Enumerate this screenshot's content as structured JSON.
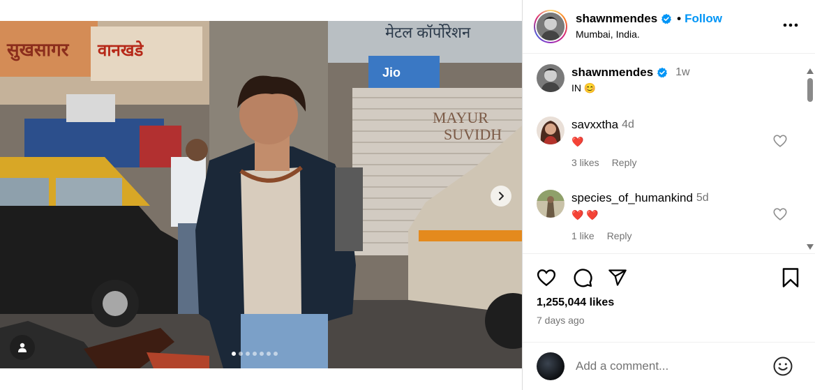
{
  "post": {
    "username": "shawnmendes",
    "follow_label": "Follow",
    "location": "Mumbai, India.",
    "caption": {
      "username": "shawnmendes",
      "time": "1w",
      "text": "IN 😊"
    },
    "media": {
      "carousel_count": 7,
      "active_index": 0,
      "signage": {
        "sign1": "सुखसागर",
        "sign2": "वानखडे",
        "corp": "मेटल कॉर्पोरेशन",
        "jio": "Jio",
        "mayur1": "MAYUR",
        "mayur2": "SUVIDH"
      }
    },
    "comments": [
      {
        "username": "savxxtha",
        "time": "4d",
        "text": "❤️",
        "likes": "3 likes",
        "reply": "Reply"
      },
      {
        "username": "species_of_humankind",
        "time": "5d",
        "text": "❤️ ❤️",
        "likes": "1 like",
        "reply": "Reply"
      }
    ],
    "likes_count": "1,255,044 likes",
    "posted": "7 days ago",
    "add_comment_placeholder": "Add a comment...",
    "icons": {
      "like": "heart-icon",
      "comment": "comment-bubble-icon",
      "share": "paper-plane-icon",
      "save": "bookmark-icon",
      "more": "more-horizontal-icon",
      "verified": "verified-badge-icon",
      "emoji": "smiley-icon",
      "next": "chevron-right-icon",
      "tag": "user-tag-icon"
    },
    "colors": {
      "link": "#0095f6",
      "heart_red": "#ed1c3a",
      "muted": "#737373"
    }
  }
}
